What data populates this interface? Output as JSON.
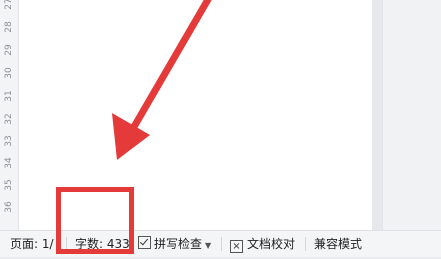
{
  "ruler": {
    "numbers": [
      "27",
      "28",
      "29",
      "30",
      "31",
      "32",
      "33",
      "34",
      "35",
      "36"
    ]
  },
  "statusbar": {
    "page_label": "页面: 1/",
    "word_count": "字数: 433",
    "spell_check": "拼写检查",
    "doc_proofread": "文档校对",
    "compat_mode": "兼容模式"
  },
  "annotation": {
    "color": "#e43a3a"
  }
}
